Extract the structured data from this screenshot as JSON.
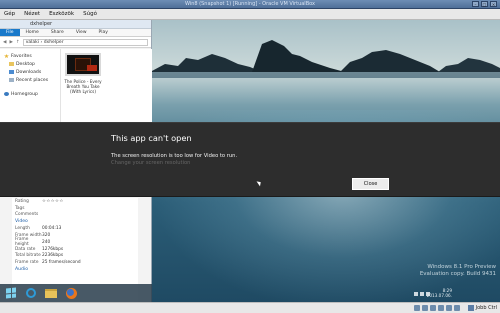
{
  "vbox": {
    "window_title": "Win8 (Snapshot 1) [Running] - Oracle VM VirtualBox",
    "menu": [
      "Gép",
      "Nézet",
      "Eszközök",
      "Súgó"
    ],
    "host_key": "Jobb Ctrl"
  },
  "explorer": {
    "title": "dxhelper",
    "ribbon_tabs": [
      "File",
      "Home",
      "Share",
      "View",
      "Play"
    ],
    "address": [
      "valaki",
      "dxhelper"
    ],
    "nav": {
      "favorites": "Favorites",
      "items": [
        "Desktop",
        "Downloads",
        "Recent places"
      ],
      "homegroup": "Homegroup"
    },
    "file": {
      "caption": "The Police - Every Breath You Take (With Lyrics)"
    },
    "details": {
      "rows_top": [
        {
          "k": "Rating",
          "v": "☆☆☆☆☆"
        },
        {
          "k": "Tags",
          "v": ""
        },
        {
          "k": "Comments",
          "v": ""
        }
      ],
      "video_header": "Video",
      "video_rows": [
        {
          "k": "Length",
          "v": "00:04:13"
        },
        {
          "k": "Frame width",
          "v": "320"
        },
        {
          "k": "Frame height",
          "v": "240"
        },
        {
          "k": "Data rate",
          "v": "1276kbps"
        },
        {
          "k": "Total bitrate",
          "v": "2236kbps"
        },
        {
          "k": "Frame rate",
          "v": "25 frames/second"
        }
      ],
      "audio_header": "Audio"
    }
  },
  "dialog": {
    "title": "This app can't open",
    "message": "The screen resolution is too low for Video to run.",
    "link": "Change your screen resolution",
    "close_label": "Close"
  },
  "watermark": {
    "line1": "Windows 8.1 Pro Preview",
    "line2": "Evaluation copy. Build 9431"
  },
  "clock": {
    "time": "8:29",
    "date": "2013.07.06."
  },
  "icons": {
    "start": "windows-logo-icon",
    "ie": "internet-explorer-icon",
    "explorer": "folder-icon",
    "firefox": "firefox-icon"
  }
}
